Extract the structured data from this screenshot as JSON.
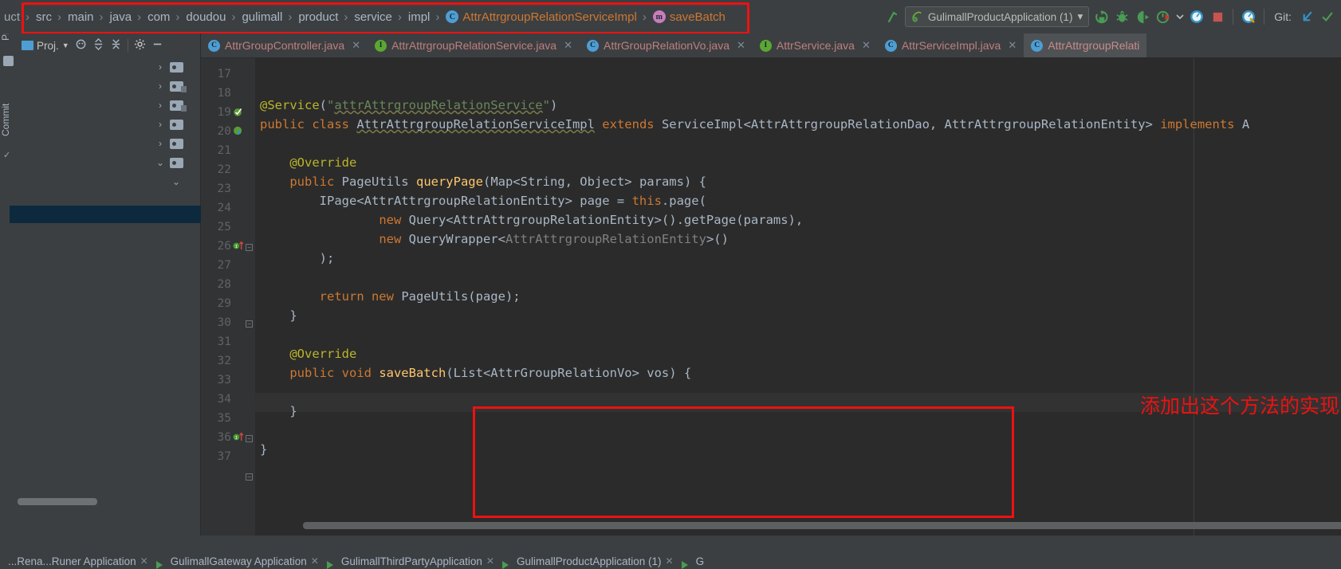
{
  "breadcrumb": {
    "prefix": "uct",
    "items": [
      {
        "label": "src",
        "icon": ""
      },
      {
        "label": "main",
        "icon": ""
      },
      {
        "label": "java",
        "icon": ""
      },
      {
        "label": "com",
        "icon": ""
      },
      {
        "label": "doudou",
        "icon": ""
      },
      {
        "label": "gulimall",
        "icon": ""
      },
      {
        "label": "product",
        "icon": ""
      },
      {
        "label": "service",
        "icon": ""
      },
      {
        "label": "impl",
        "icon": ""
      },
      {
        "label": "AttrAttrgroupRelationServiceImpl",
        "icon": "class-icon"
      },
      {
        "label": "saveBatch",
        "icon": "method-icon"
      }
    ]
  },
  "toolbar": {
    "run_config": "GulimallProductApplication (1)",
    "dropdown_caret": "▾",
    "git_label": "Git:",
    "icons": [
      "back-arrow-icon",
      "run-icon",
      "debug-icon",
      "run-coverage-icon",
      "profiler-icon",
      "caret-down-icon",
      "search-everywhere-icon",
      "stop-icon",
      "updates-icon",
      "git-update-icon"
    ]
  },
  "left_strip": {
    "tabs": [
      "Project",
      "Commit"
    ]
  },
  "project_panel": {
    "title": "Proj.",
    "toolbar_icons": [
      "project-view-icon",
      "locate-icon",
      "expand-all-icon",
      "collapse-all-icon",
      "settings-gear-icon",
      "hide-icon"
    ],
    "tree_rows": [
      {
        "chevron": "›",
        "icon": "folder-icon"
      },
      {
        "chevron": "›",
        "icon": "folder-source-icon"
      },
      {
        "chevron": "›",
        "icon": "folder-source-icon"
      },
      {
        "chevron": "›",
        "icon": "folder-icon"
      },
      {
        "chevron": "›",
        "icon": "folder-icon"
      },
      {
        "chevron": "⌄",
        "icon": "folder-icon"
      },
      {
        "chevron": "⌄",
        "icon": ""
      }
    ]
  },
  "editor_tabs": [
    {
      "label": "AttrGroupController.java",
      "icon": "class-icon",
      "active": false,
      "closable": true
    },
    {
      "label": "AttrAttrgroupRelationService.java",
      "icon": "interface-icon",
      "active": false,
      "closable": true
    },
    {
      "label": "AttrGroupRelationVo.java",
      "icon": "class-icon",
      "active": false,
      "closable": true
    },
    {
      "label": "AttrService.java",
      "icon": "interface-icon",
      "active": false,
      "closable": true
    },
    {
      "label": "AttrServiceImpl.java",
      "icon": "class-icon",
      "active": false,
      "closable": true
    },
    {
      "label": "AttrAttrgroupRelati",
      "icon": "class-icon",
      "active": true,
      "closable": false
    }
  ],
  "editor": {
    "line_numbers": [
      "17",
      "18",
      "19",
      "20",
      "21",
      "22",
      "23",
      "24",
      "25",
      "26",
      "27",
      "28",
      "29",
      "30",
      "31",
      "32",
      "33",
      "34",
      "35",
      "36",
      "37"
    ],
    "code_lines": [
      {
        "num": "19",
        "text": "@Service(\"attrAttrgroupRelationService\")"
      },
      {
        "num": "20",
        "text": "public class AttrAttrgroupRelationServiceImpl extends ServiceImpl<AttrAttrgroupRelationDao, AttrAttrgroupRelationEntity> implements A"
      },
      {
        "num": "22",
        "text": "    @Override"
      },
      {
        "num": "23",
        "text": "    public PageUtils queryPage(Map<String, Object> params) {"
      },
      {
        "num": "24",
        "text": "        IPage<AttrAttrgroupRelationEntity> page = this.page("
      },
      {
        "num": "25",
        "text": "                new Query<AttrAttrgroupRelationEntity>().getPage(params),"
      },
      {
        "num": "26",
        "text": "                new QueryWrapper<AttrAttrgroupRelationEntity>()"
      },
      {
        "num": "27",
        "text": "        );"
      },
      {
        "num": "29",
        "text": "        return new PageUtils(page);"
      },
      {
        "num": "30",
        "text": "    }"
      },
      {
        "num": "32",
        "text": "    @Override"
      },
      {
        "num": "33",
        "text": "    public void saveBatch(List<AttrGroupRelationVo> vos) {"
      },
      {
        "num": "35",
        "text": "    }"
      },
      {
        "num": "37",
        "text": "}"
      }
    ],
    "highlighted_line": "34",
    "annotation_note": "添加出这个方法的实现",
    "annotation_color": "#ee1111"
  },
  "bottom_bar": {
    "items": [
      {
        "label": "...Rena...Runer Application"
      },
      {
        "label": "GulimallGateway Application"
      },
      {
        "label": "GulimallThirdPartyApplication"
      },
      {
        "label": "GulimallProductApplication (1)"
      },
      {
        "label": "G"
      }
    ]
  },
  "colors": {
    "background": "#3c3f41",
    "editor_bg": "#2b2b2b",
    "gutter_bg": "#313335",
    "annotation_red": "#ee1111",
    "keyword": "#cc7832",
    "string": "#6a8759",
    "method": "#ffc66d",
    "annotation_yellow": "#bbb529",
    "text": "#a9b7c6"
  }
}
